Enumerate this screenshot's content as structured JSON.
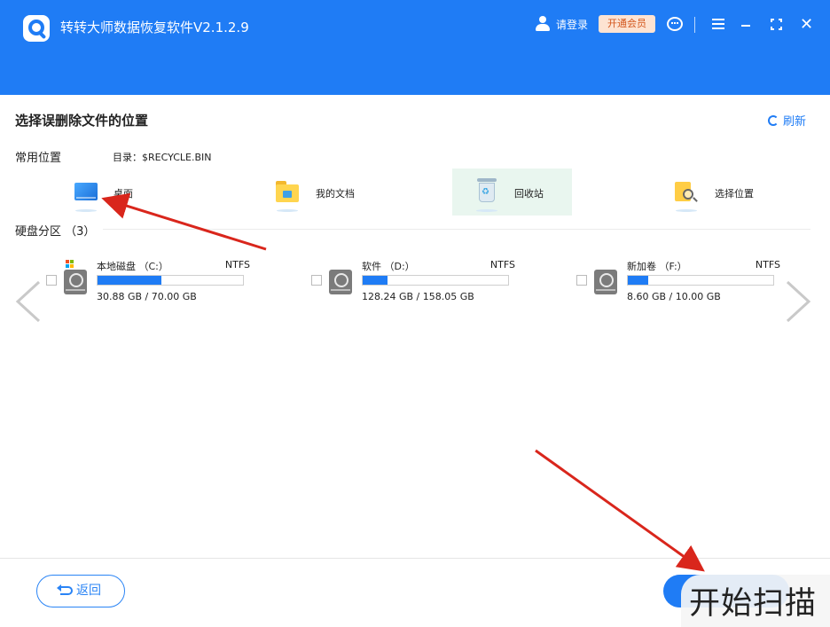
{
  "header": {
    "app_title": "转转大师数据恢复软件V2.1.2.9",
    "login_label": "请登录",
    "vip_label": "开通会员",
    "close_glyph": "✕"
  },
  "content": {
    "section_title": "选择误删除文件的位置",
    "refresh_label": "刷新",
    "common_label": "常用位置",
    "directory_label": "目录：$RECYCLE.BIN",
    "locations": [
      {
        "label": "桌面",
        "icon": "desktop-icon"
      },
      {
        "label": "我的文档",
        "icon": "documents-folder-icon"
      },
      {
        "label": "回收站",
        "icon": "recycle-bin-icon",
        "selected": true
      },
      {
        "label": "选择位置",
        "icon": "choose-location-icon"
      }
    ],
    "disk_label": "硬盘分区 （3）",
    "drives": [
      {
        "name": "本地磁盘 （C:）",
        "fs": "NTFS",
        "size": "30.88 GB / 70.00 GB",
        "used_fraction": 0.44
      },
      {
        "name": "软件 （D:）",
        "fs": "NTFS",
        "size": "128.24 GB / 158.05 GB",
        "used_fraction": 0.17
      },
      {
        "name": "新加卷 （F:）",
        "fs": "NTFS",
        "size": "8.60 GB / 10.00 GB",
        "used_fraction": 0.14
      }
    ]
  },
  "footer": {
    "back_label": "返回",
    "scan_label": "开始扫描"
  },
  "colors": {
    "accent": "#1f7cf5",
    "annotation_arrow": "#d9261c",
    "vip_bg": "#fde3d2",
    "vip_text": "#d3561c"
  }
}
